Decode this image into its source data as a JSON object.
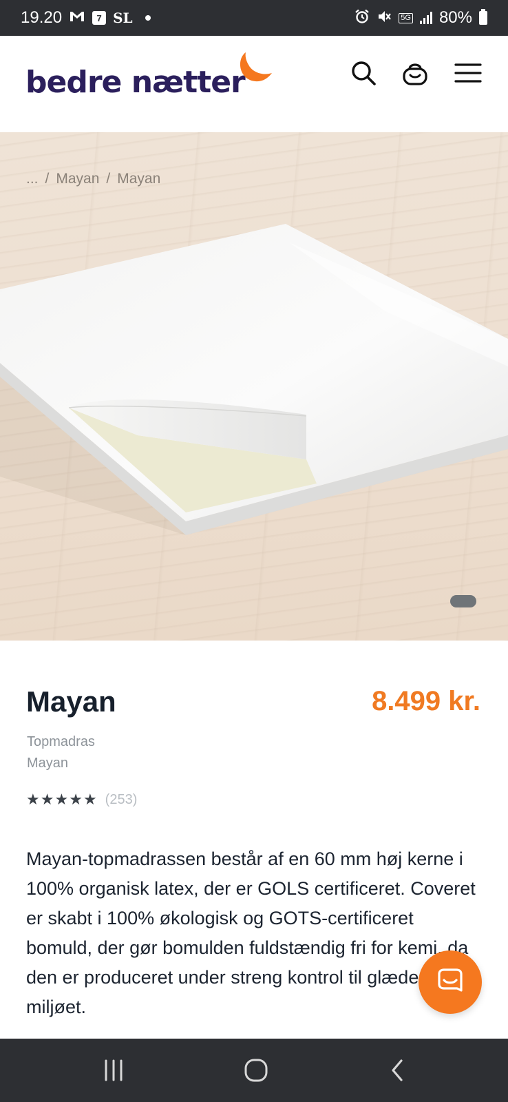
{
  "status_bar": {
    "time": "19.20",
    "calendar_day": "7",
    "carrier_tag": "SL",
    "network": "5G",
    "battery": "80%"
  },
  "header": {
    "logo_text": "bedre nætter",
    "brand_color": "#2b1f5c",
    "accent_color": "#f5781f",
    "icons": [
      "search-icon",
      "basket-icon",
      "menu-icon"
    ]
  },
  "breadcrumb": {
    "items": [
      "...",
      "Mayan",
      "Mayan"
    ],
    "separator": "/"
  },
  "carousel": {
    "active_index": 0,
    "count": 1
  },
  "product": {
    "title": "Mayan",
    "price": "8.499 kr.",
    "category": "Topmadras",
    "brand": "Mayan",
    "rating": 5,
    "review_count": "(253)",
    "description": "Mayan-topmadrassen består af en 60 mm høj kerne i 100% organisk latex, der er GOLS certificeret. Coveret er skabt i 100% økologisk og GOTS-certificeret bomuld, der gør bomulden fuldstændig fri for kemi, da den er produceret under streng kontrol til glæde for miljøet."
  },
  "chat": {
    "icon": "chat-bubble-icon"
  },
  "nav_bar": {
    "buttons": [
      "recent-apps-icon",
      "home-icon",
      "back-icon"
    ]
  }
}
